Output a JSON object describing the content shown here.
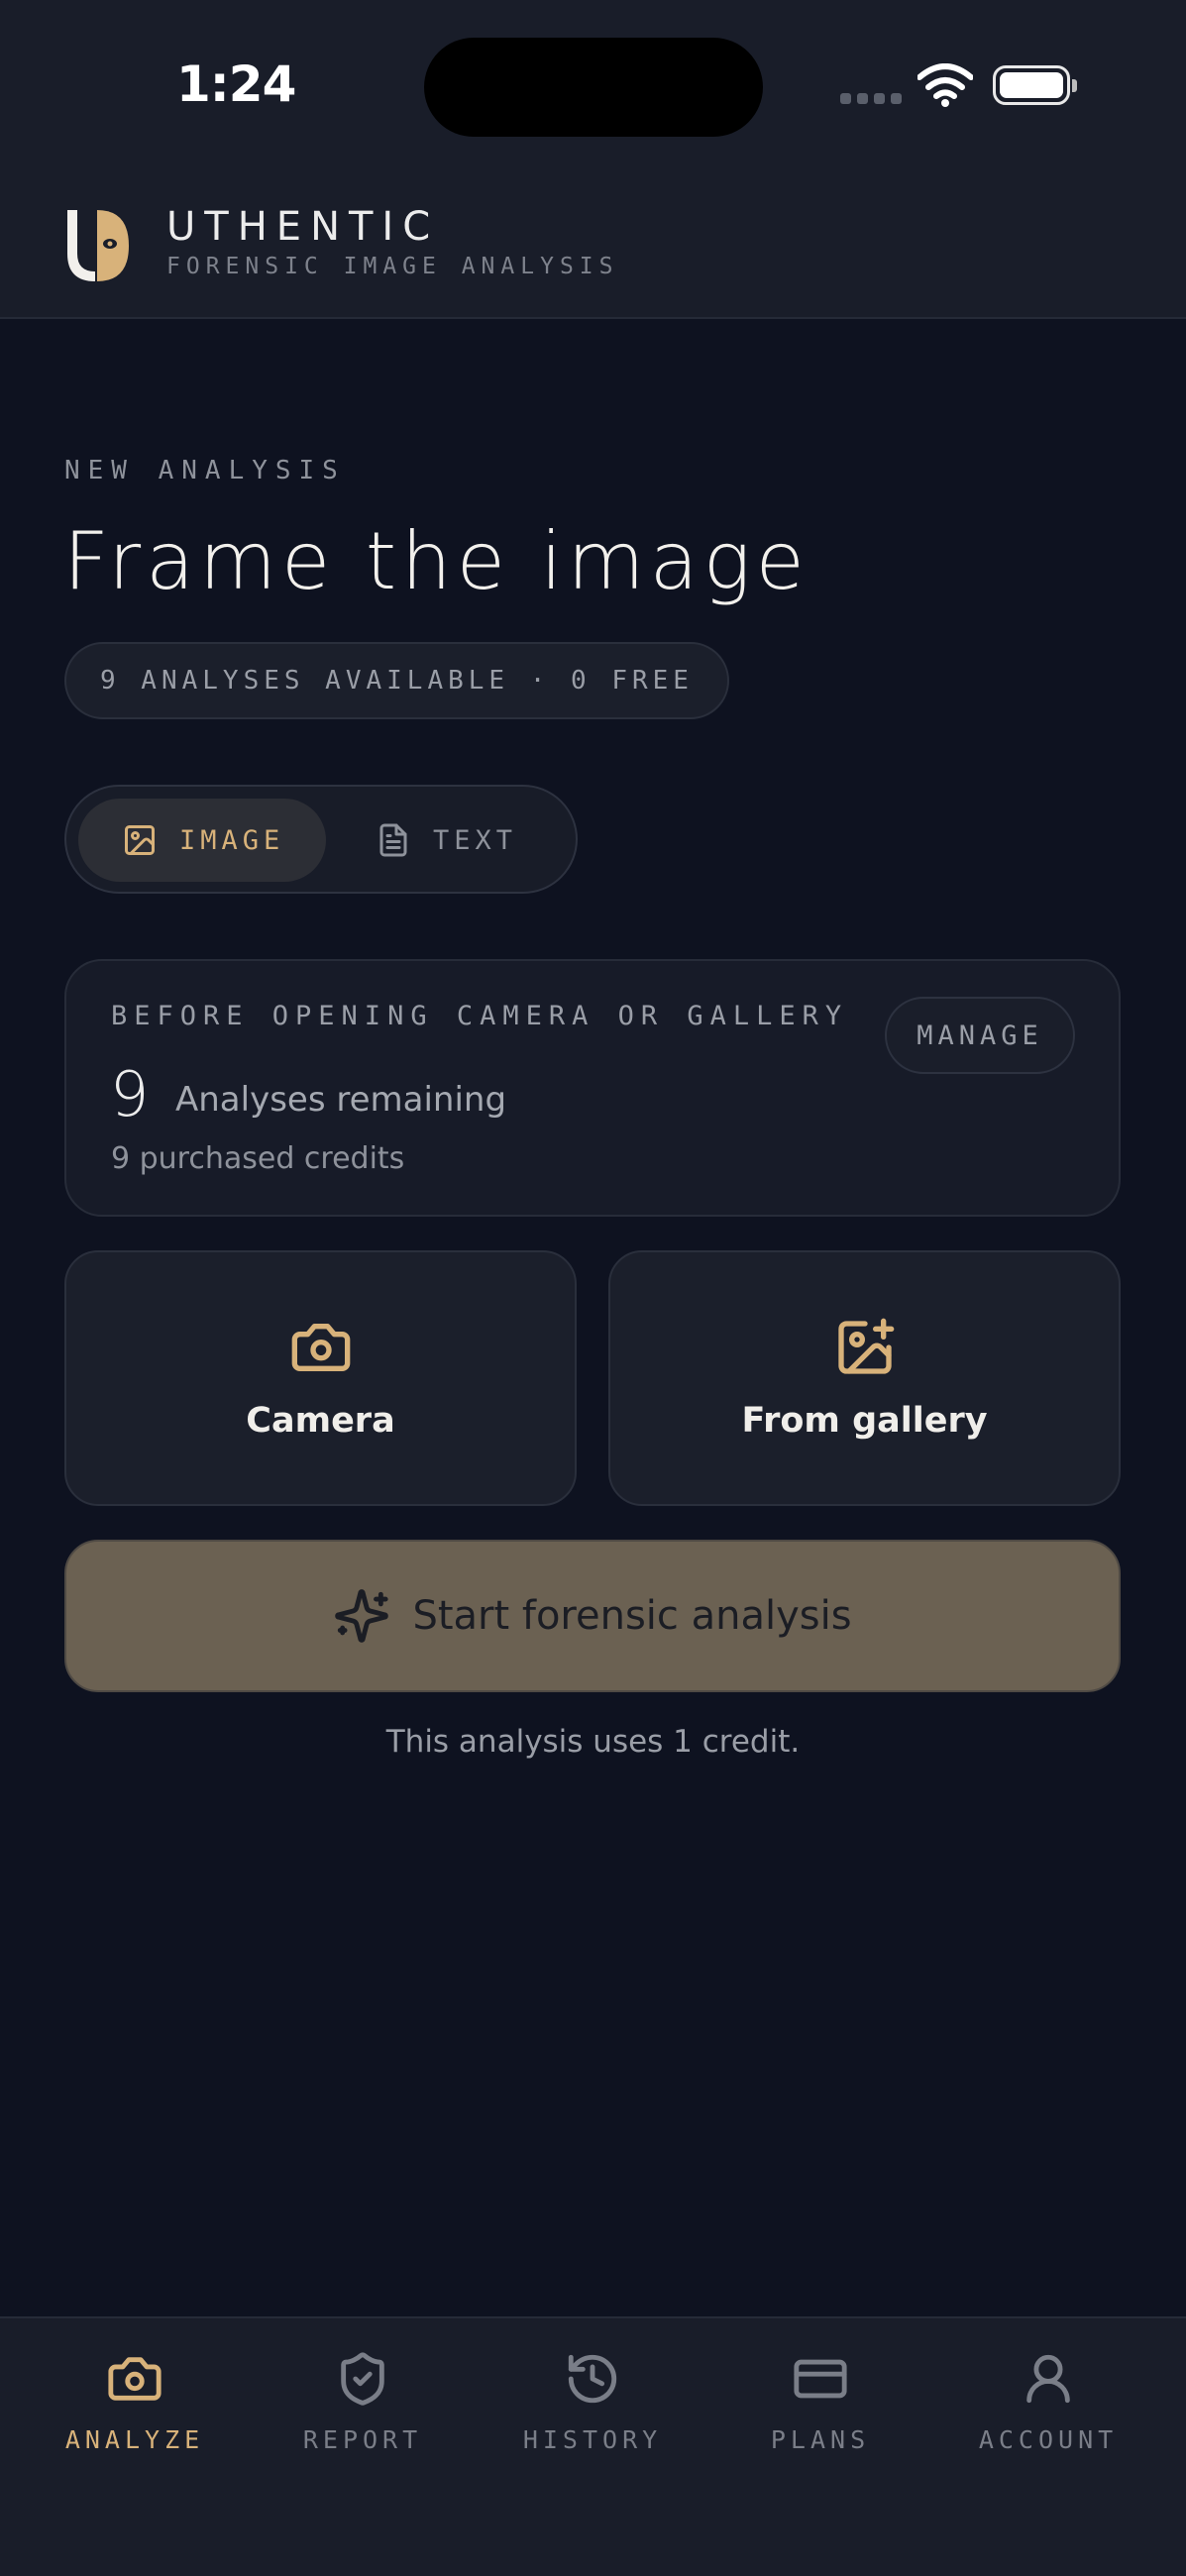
{
  "status_bar": {
    "time": "1:24"
  },
  "header": {
    "brand": "UTHENTIC",
    "tagline": "FORENSIC IMAGE ANALYSIS"
  },
  "hero": {
    "eyebrow": "NEW ANALYSIS",
    "title": "Frame the image",
    "availability": "9 ANALYSES AVAILABLE · 0 FREE"
  },
  "mode_toggle": {
    "options": [
      {
        "label": "IMAGE",
        "icon": "image-icon",
        "selected": true
      },
      {
        "label": "TEXT",
        "icon": "document-icon",
        "selected": false
      }
    ]
  },
  "credits_card": {
    "eyebrow": "BEFORE OPENING CAMERA OR GALLERY",
    "count": "9",
    "count_label": "Analyses remaining",
    "sub": "9 purchased credits",
    "manage_label": "MANAGE"
  },
  "sources": [
    {
      "label": "Camera",
      "icon": "camera-icon"
    },
    {
      "label": "From gallery",
      "icon": "image-plus-icon"
    }
  ],
  "start_button": {
    "label": "Start forensic analysis",
    "icon": "sparkles-icon"
  },
  "credit_note": "This analysis uses 1 credit.",
  "tab_bar": {
    "tabs": [
      {
        "label": "ANALYZE",
        "icon": "camera-icon",
        "active": true
      },
      {
        "label": "REPORT",
        "icon": "shield-check-icon",
        "active": false
      },
      {
        "label": "HISTORY",
        "icon": "history-icon",
        "active": false
      },
      {
        "label": "PLANS",
        "icon": "credit-card-icon",
        "active": false
      },
      {
        "label": "ACCOUNT",
        "icon": "user-icon",
        "active": false
      }
    ]
  },
  "colors": {
    "background": "#0e1220",
    "surface": "#1b1f2b",
    "accent": "#d8b27a",
    "start_button": "#6b6152",
    "muted_text": "#8e929b"
  }
}
